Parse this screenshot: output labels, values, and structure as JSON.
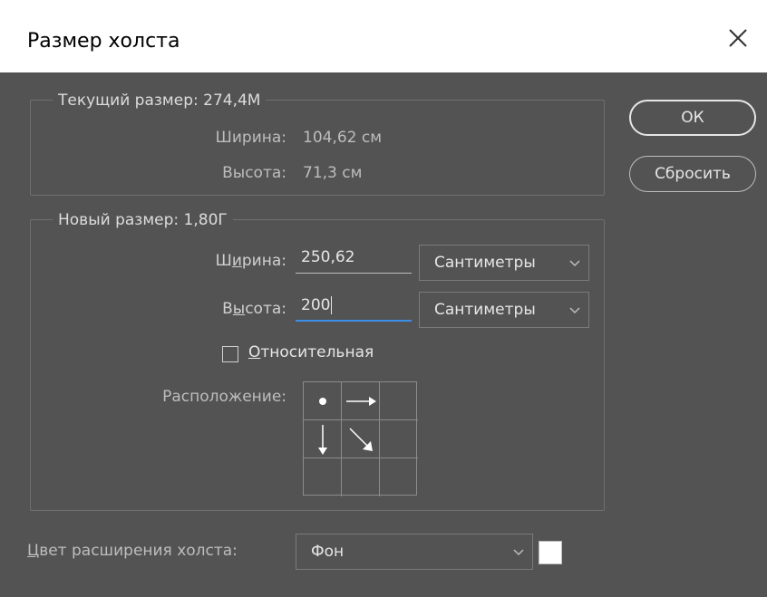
{
  "dialog": {
    "title": "Размер холста",
    "close_icon": "close-icon"
  },
  "current_size": {
    "legend": "Текущий размер:  274,4M",
    "width_label": "Ширина:",
    "width_value": "104,62 см",
    "height_label": "Высота:",
    "height_value": "71,3 см"
  },
  "new_size": {
    "legend": "Новый размер: 1,80Г",
    "width_label_prefix": "Ш",
    "width_label_underlined": "и",
    "width_label_suffix": "рина:",
    "width_value": "250,62",
    "width_unit": "Сантиметры",
    "height_label_prefix": "В",
    "height_label_underlined": "ы",
    "height_label_suffix": "сота:",
    "height_value": "200",
    "height_unit": "Сантиметры",
    "relative_underlined": "О",
    "relative_rest": "тносительная",
    "anchor_label": "Расположение:"
  },
  "buttons": {
    "ok": "ОК",
    "reset": "Сбросить"
  },
  "extension": {
    "label_underlined": "Ц",
    "label_rest": "вет расширения холста:",
    "value": "Фон",
    "swatch_color": "#ffffff"
  }
}
